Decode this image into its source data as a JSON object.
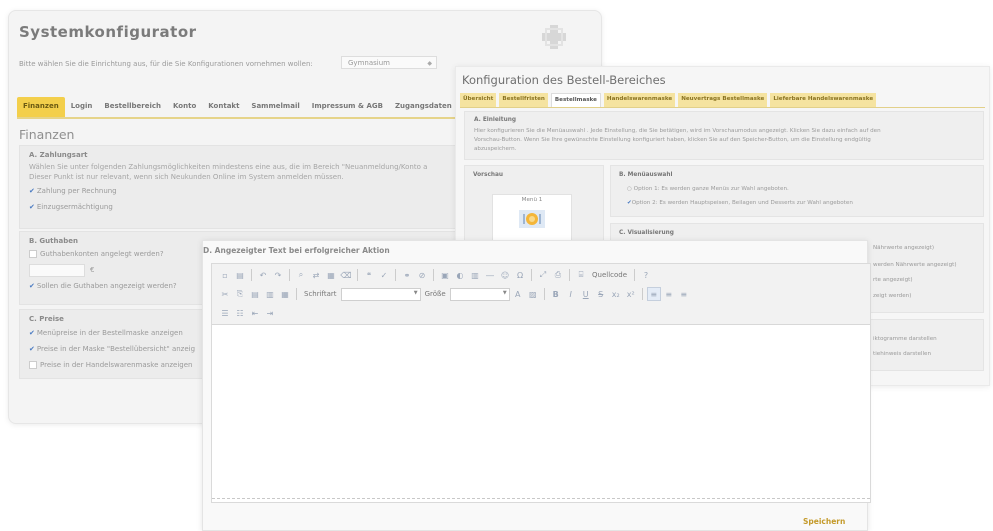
{
  "system": {
    "title": "Systemkonfigurator",
    "intro": "Bitte wählen Sie die Einrichtung aus, für die Sie Konfigurationen vornehmen wollen:",
    "select_value": "Gymnasium",
    "tabs": [
      "Finanzen",
      "Login",
      "Bestellbereich",
      "Konto",
      "Kontakt",
      "Sammelmail",
      "Impressum & AGB",
      "Zugangsdaten"
    ],
    "section_title": "Finanzen",
    "zahlungsart": {
      "title": "A. Zahlungsart",
      "desc1": "Wählen Sie unter folgenden Zahlungsmöglichkeiten mindestens eine aus, die im Bereich \"Neuanmeldung/Konto a",
      "desc2": "Dieser Punkt ist nur relevant, wenn sich Neukunden Online im System anmelden müssen.",
      "opt1": "Zahlung per Rechnung",
      "opt2": "Einzugsermächtigung"
    },
    "guthaben": {
      "title": "B. Guthaben",
      "q1": "Guthabenkonten angelegt werden?",
      "currency": "€",
      "q2": "Sollen die Guthaben angezeigt werden?"
    },
    "preise": {
      "title": "C. Preise",
      "opt1": "Menüpreise in der Bestellmaske anzeigen",
      "opt2": "Preise in der Maske \"Bestellübersicht\" anzeig",
      "opt3": "Preise in der Handelswarenmaske anzeigen"
    }
  },
  "bestell": {
    "title": "Konfiguration des Bestell-Bereiches",
    "tabs": [
      "Übersicht",
      "Bestellfristen",
      "Bestellmaske",
      "Handelswarenmaske",
      "Neuvertrags Bestellmaske",
      "Lieferbare Handelswarenmaske"
    ],
    "einleitung": {
      "title": "A. Einleitung",
      "text1": "Hier konfigurieren Sie die Menüauswahl . Jede Einstellung, die Sie betätigen, wird im Vorschaumodus angezeigt. Klicken Sie dazu einfach auf den",
      "text2": "Vorschau-Button. Wenn Sie Ihre gewünschte Einstellung konfiguriert haben, klicken Sie auf den Speicher-Button, um die Einstellung endgültig",
      "text3": "abzuspeichern."
    },
    "vorschau": {
      "title": "Vorschau",
      "menu_label": "Menü 1"
    },
    "menuauswahl": {
      "title": "B. Menüauswahl",
      "opt1": "Option 1: Es werden ganze Menüs zur Wahl angeboten.",
      "opt2": "Option 2: Es werden Hauptspeisen, Beilagen und Desserts zur Wahl angeboten"
    },
    "visualisierung": {
      "title": "C. Visualisierung"
    },
    "tails": [
      "Nährwerte angezeigt)",
      "werden Nährwerte angezeigt)",
      "rte angezeigt)",
      "zeigt werden)",
      "iktogramme darstellen",
      "tiehinweis darstellen"
    ]
  },
  "editor": {
    "title": "D. Angezeigter Text bei erfolgreicher Aktion",
    "source_label": "Quellcode",
    "font_label": "Schriftart",
    "size_label": "Größe",
    "save_label": "Speichern"
  }
}
